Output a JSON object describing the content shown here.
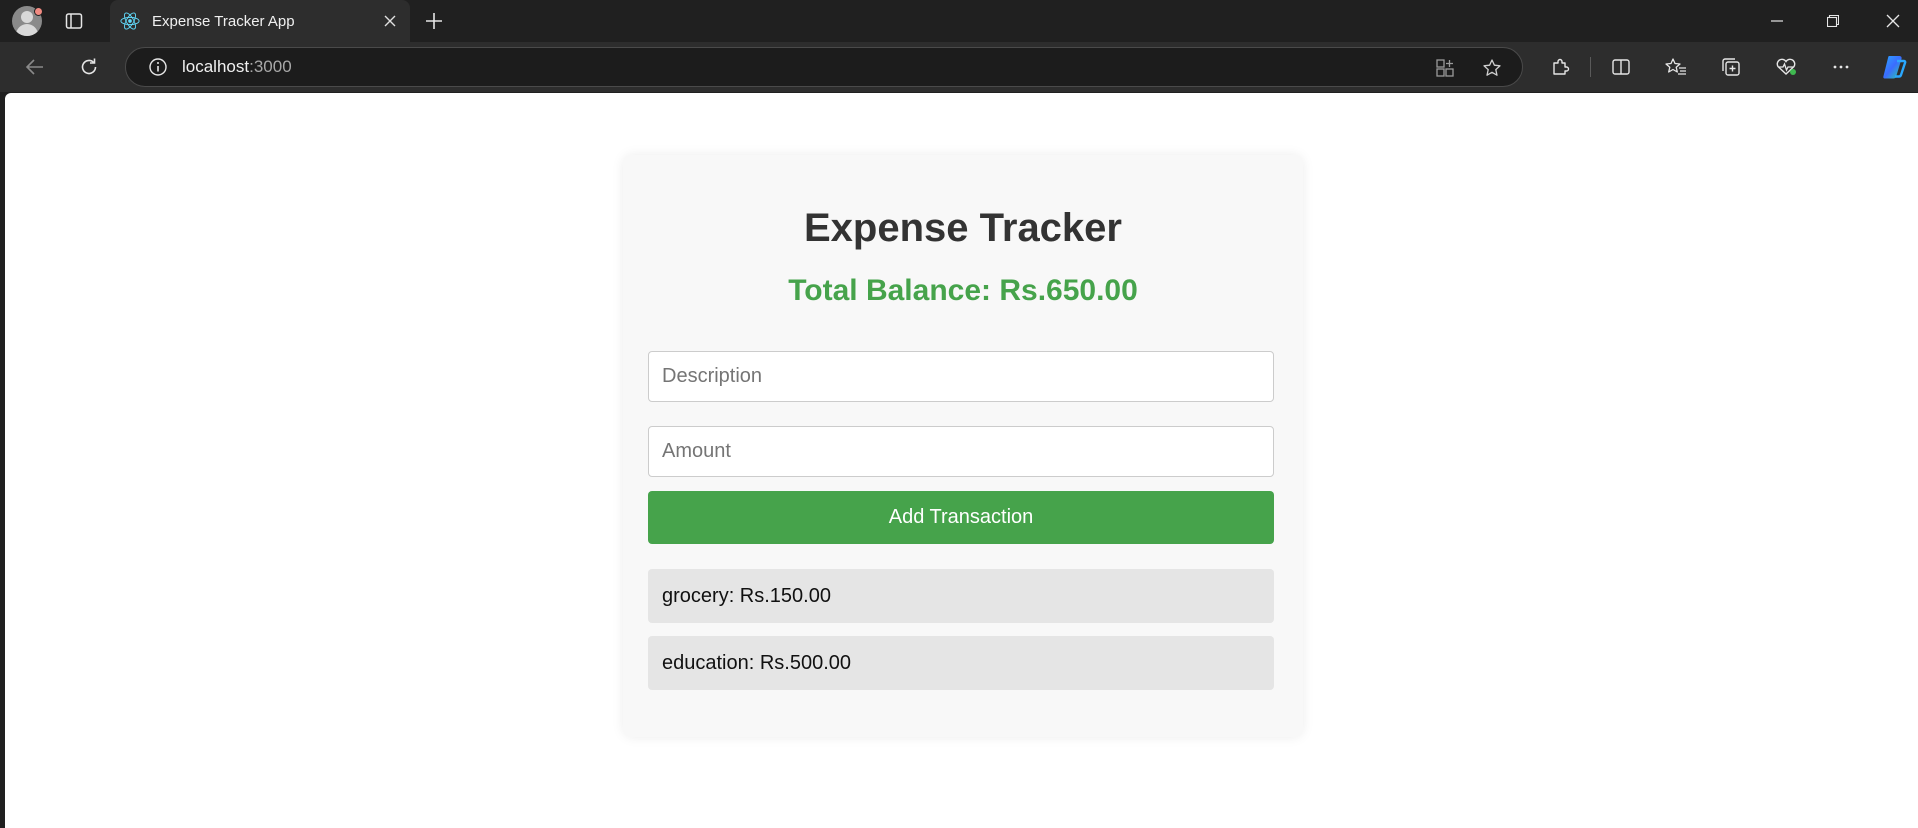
{
  "browser": {
    "tab_title": "Expense Tracker App",
    "url_host": "localhost",
    "url_port": ":3000"
  },
  "app": {
    "title": "Expense Tracker",
    "balance_text": "Total Balance: Rs.650.00",
    "balance_color": "#46a34b",
    "description_placeholder": "Description",
    "amount_placeholder": "Amount",
    "add_button_label": "Add Transaction",
    "add_button_color": "#46a34b",
    "transactions": [
      {
        "label": "grocery: Rs.150.00"
      },
      {
        "label": "education: Rs.500.00"
      }
    ]
  },
  "icons": {
    "tab_favicon": "react-icon",
    "back": "back-arrow-icon",
    "refresh": "refresh-icon",
    "info": "info-icon",
    "favorite": "star-icon",
    "extensions": "puzzle-icon",
    "split_screen": "split-screen-icon",
    "favorites": "favorites-icon",
    "collections": "collections-icon",
    "health": "heartbeat-icon",
    "more": "more-icon",
    "copilot": "copilot-icon"
  }
}
